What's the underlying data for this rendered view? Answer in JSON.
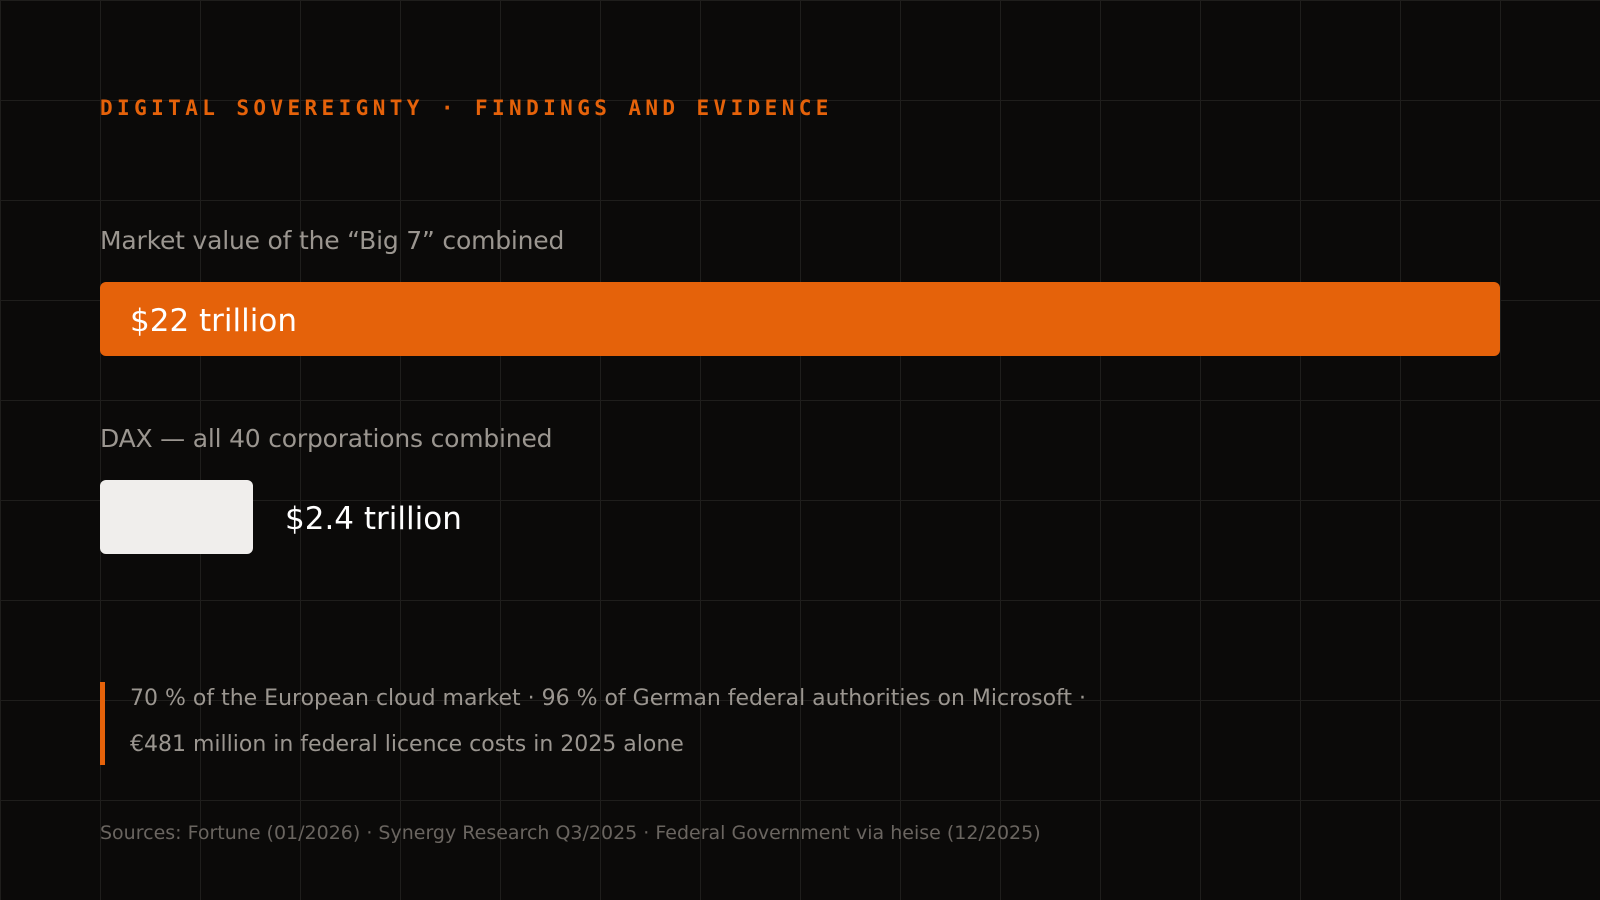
{
  "header": {
    "eyebrow": "DIGITAL SOVEREIGNTY · FINDINGS AND EVIDENCE"
  },
  "chart_data": {
    "type": "bar",
    "orientation": "horizontal",
    "unit": "trillion USD",
    "categories": [
      "Market value of the “Big 7” combined",
      "DAX — all 40 corporations combined"
    ],
    "values": [
      22,
      2.4
    ],
    "value_labels": [
      "$22 trillion",
      "$2.4 trillion"
    ],
    "colors": [
      "#e5620a",
      "#f0eeec"
    ],
    "xlim": [
      0,
      22
    ],
    "grid": false
  },
  "note": {
    "lines": [
      "70 % of the European cloud market · 96 % of German federal authorities on Microsoft ·",
      "€481 million in federal licence costs in 2025 alone"
    ]
  },
  "footer": {
    "sources": "Sources: Fortune (01/2026) · Synergy Research Q3/2025 · Federal Government via heise (12/2025)"
  }
}
